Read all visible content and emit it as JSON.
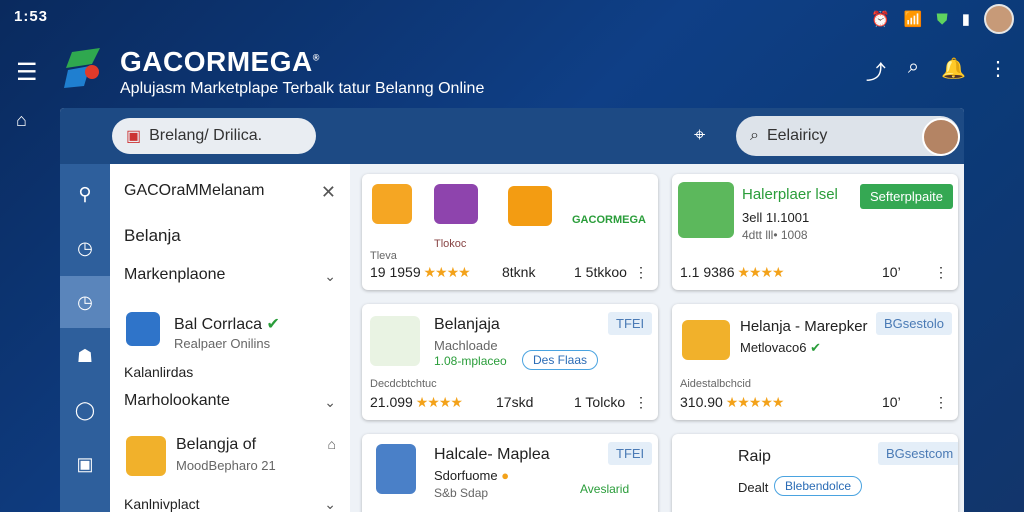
{
  "status": {
    "time": "1:53"
  },
  "header": {
    "brand": "GACORMEGA",
    "trademark": "®",
    "tagline": "Aplujasm Marketplape Terbalk tatur Belanng Online"
  },
  "toolbar": {
    "search_value": "Brelang/ Drilica.",
    "search2_value": "Eelairicy"
  },
  "sidebar": {
    "title": "GACOraMMelanam",
    "items": [
      {
        "label": "Belanja"
      },
      {
        "label": "Markenplaone"
      },
      {
        "label": "Bal Corrlaca",
        "sub": "Realpaer Onilins"
      },
      {
        "label": "Kalanlirdas"
      },
      {
        "label": "Marholookante"
      },
      {
        "label": "Belangja of",
        "sub": "MoodBepharo 21"
      },
      {
        "label": "Kanlnivplact"
      }
    ]
  },
  "cards": [
    {
      "caption": "Tlokoc",
      "foot_label": "Tleva",
      "rating": "19 1959",
      "count": "8tknk",
      "price": "1 5tkkoo",
      "brand_small": "GACORMEGA"
    },
    {
      "title": "Halerplaer lsel",
      "badge": "Sefterplpaite",
      "line1": "3ell 1I.1001",
      "line2": "4dtt lll• 1008",
      "rating": "1.1 9386",
      "count": "10’"
    },
    {
      "title": "Belanjaja",
      "sub": "Machloade",
      "line": "1.08-mplaceo",
      "pill": "Des Flaas",
      "tag": "TFEI",
      "foot_label": "Decdcbtchtuc",
      "rating": "21.099",
      "count": "17skd",
      "price": "1 Tolcko"
    },
    {
      "title": "Helanja - Marepker",
      "sub": "Metlovaco6",
      "tag": "BGsestolo",
      "foot_label": "Aidestalbchcid",
      "rating": "310.90",
      "count": "10’"
    },
    {
      "title": "Halcale- Maplea",
      "sub": "Sdorfuome",
      "sub2": "S&b Sdap",
      "tag": "TFEI",
      "green": "Aveslarid"
    },
    {
      "title": "Raip",
      "sub": "Dealt",
      "pill": "Blebendolce",
      "tag": "BGsestcom"
    }
  ],
  "colors": {
    "accent": "#2a9d3a",
    "nav": "#1d4a84",
    "rail": "#2e5f9c"
  }
}
